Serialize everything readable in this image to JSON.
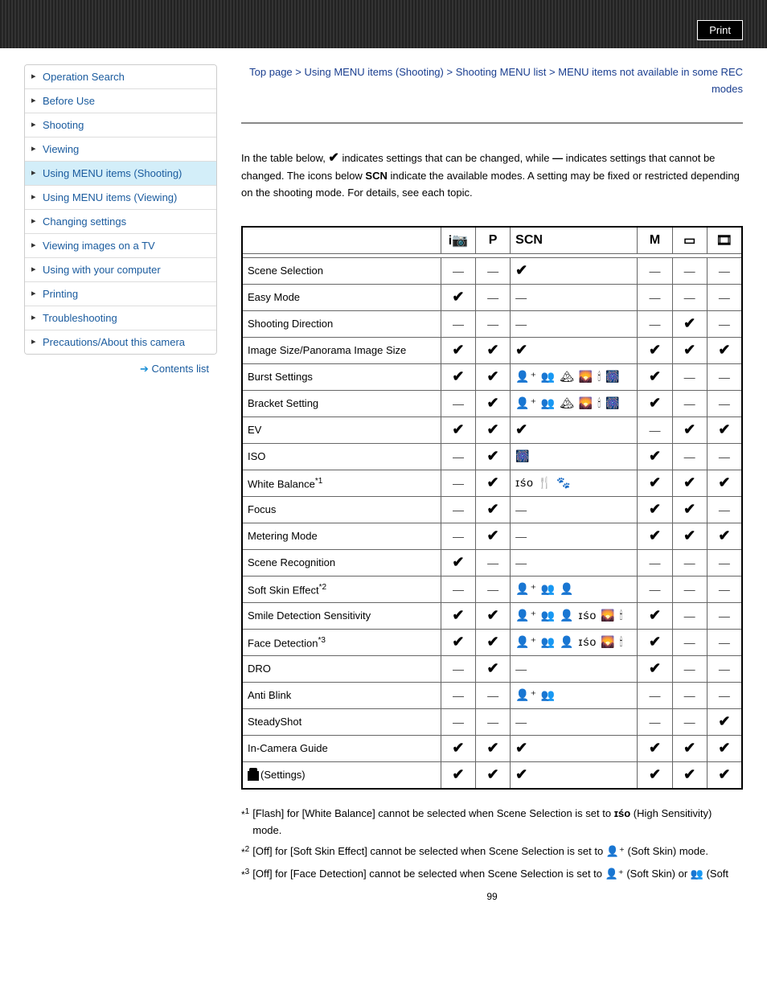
{
  "print_button": "Print",
  "sidebar": {
    "items": [
      {
        "label": "Operation Search"
      },
      {
        "label": "Before Use"
      },
      {
        "label": "Shooting"
      },
      {
        "label": "Viewing"
      },
      {
        "label": "Using MENU items (Shooting)",
        "active": true
      },
      {
        "label": "Using MENU items (Viewing)"
      },
      {
        "label": "Changing settings"
      },
      {
        "label": "Viewing images on a TV"
      },
      {
        "label": "Using with your computer"
      },
      {
        "label": "Printing"
      },
      {
        "label": "Troubleshooting"
      },
      {
        "label": "Precautions/About this camera"
      }
    ],
    "contents_list": "Contents list"
  },
  "breadcrumb": {
    "items": [
      "Top page",
      "Using MENU items (Shooting)",
      "Shooting MENU list",
      "MENU items not available in some REC modes"
    ],
    "sep": " > "
  },
  "intro": {
    "part1": "In the table below, ",
    "part2": " indicates settings that can be changed, while ",
    "part3": " indicates settings that cannot be changed. The icons below ",
    "part4": " indicate the available modes. A setting may be fixed or restricted depending on the shooting mode. For details, see each topic.",
    "scn": "SCN"
  },
  "table": {
    "headers": {
      "auto": "i📷",
      "p": "P",
      "scn": "SCN",
      "m": "M",
      "pan": "▭",
      "movie": "🎞"
    },
    "rows": [
      {
        "name": "Scene Selection",
        "c": [
          "—",
          "—",
          "✔",
          "—",
          "—",
          "—"
        ],
        "scn_type": "check"
      },
      {
        "name": "Easy Mode",
        "c": [
          "✔",
          "—",
          "—",
          "—",
          "—",
          "—"
        ]
      },
      {
        "name": "Shooting Direction",
        "c": [
          "—",
          "—",
          "—",
          "—",
          "✔",
          "—"
        ]
      },
      {
        "name": "Image Size/Panorama Image Size",
        "c": [
          "✔",
          "✔",
          "✔",
          "✔",
          "✔",
          "✔"
        ],
        "scn_type": "check"
      },
      {
        "name": "Burst Settings",
        "c": [
          "✔",
          "✔",
          "icons1",
          "✔",
          "—",
          "—"
        ],
        "scn_icons": "👤⁺ 👥 🏔 🌄 🕯 🎆"
      },
      {
        "name": "Bracket Setting",
        "c": [
          "—",
          "✔",
          "icons1",
          "✔",
          "—",
          "—"
        ],
        "scn_icons": "👤⁺ 👥 🏔 🌄 🕯 🎆"
      },
      {
        "name": "EV",
        "c": [
          "✔",
          "✔",
          "✔",
          "—",
          "✔",
          "✔"
        ],
        "scn_type": "check"
      },
      {
        "name": "ISO",
        "c": [
          "—",
          "✔",
          "icons2",
          "✔",
          "—",
          "—"
        ],
        "scn_icons": "🎆"
      },
      {
        "name": "White Balance",
        "sup": "1",
        "c": [
          "—",
          "✔",
          "icons3",
          "✔",
          "✔",
          "✔"
        ],
        "scn_icons": "ɪśᴏ 🍴 🐾"
      },
      {
        "name": "Focus",
        "c": [
          "—",
          "✔",
          "—",
          "✔",
          "✔",
          "—"
        ]
      },
      {
        "name": "Metering Mode",
        "c": [
          "—",
          "✔",
          "—",
          "✔",
          "✔",
          "✔"
        ]
      },
      {
        "name": "Scene Recognition",
        "c": [
          "✔",
          "—",
          "—",
          "—",
          "—",
          "—"
        ]
      },
      {
        "name": "Soft Skin Effect",
        "sup": "2",
        "c": [
          "—",
          "—",
          "icons4",
          "—",
          "—",
          "—"
        ],
        "scn_icons": "👤⁺ 👥 👤"
      },
      {
        "name": "Smile Detection Sensitivity",
        "c": [
          "✔",
          "✔",
          "icons5",
          "✔",
          "—",
          "—"
        ],
        "scn_icons": "👤⁺ 👥 👤 ɪśᴏ 🌄 🕯"
      },
      {
        "name": "Face Detection",
        "sup": "3",
        "c": [
          "✔",
          "✔",
          "icons5",
          "✔",
          "—",
          "—"
        ],
        "scn_icons": "👤⁺ 👥 👤 ɪśᴏ 🌄 🕯"
      },
      {
        "name": "DRO",
        "c": [
          "—",
          "✔",
          "—",
          "✔",
          "—",
          "—"
        ]
      },
      {
        "name": "Anti Blink",
        "c": [
          "—",
          "—",
          "icons6",
          "—",
          "—",
          "—"
        ],
        "scn_icons": "👤⁺ 👥"
      },
      {
        "name": "SteadyShot",
        "c": [
          "—",
          "—",
          "—",
          "—",
          "—",
          "✔"
        ]
      },
      {
        "name": "In-Camera Guide",
        "c": [
          "✔",
          "✔",
          "✔",
          "✔",
          "✔",
          "✔"
        ],
        "scn_type": "check"
      },
      {
        "name": "(Settings)",
        "icon": "settings",
        "c": [
          "✔",
          "✔",
          "✔",
          "✔",
          "✔",
          "✔"
        ],
        "scn_type": "check"
      }
    ]
  },
  "footnotes": {
    "f1_a": "[Flash] for [White Balance] cannot be selected when Scene Selection is set to ",
    "f1_b": " (High Sensitivity) mode.",
    "f1_icon": "ɪśᴏ",
    "f2_a": "[Off] for [Soft Skin Effect] cannot be selected when Scene Selection is set to ",
    "f2_b": " (Soft Skin) mode.",
    "f2_icon": "👤⁺",
    "f3_a": "[Off] for [Face Detection] cannot be selected when Scene Selection is set to ",
    "f3_b": " (Soft Skin) or ",
    "f3_c": " (Soft",
    "f3_icon1": "👤⁺",
    "f3_icon2": "👥"
  },
  "page_number": "99"
}
